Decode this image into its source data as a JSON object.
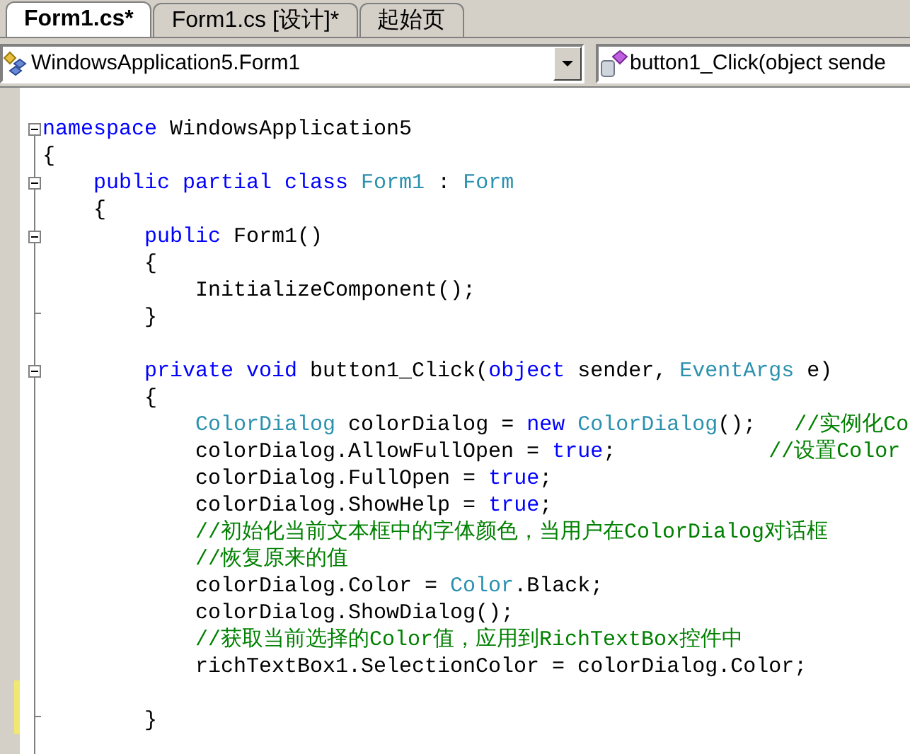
{
  "tabs": [
    {
      "label": "Form1.cs*",
      "selected": true
    },
    {
      "label": "Form1.cs [设计]*",
      "selected": false
    },
    {
      "label": "起始页",
      "selected": false
    }
  ],
  "type_combo": {
    "value": "WindowsApplication5.Form1"
  },
  "member_combo": {
    "value": "button1_Click(object sende"
  },
  "lines": [
    {
      "collapsible": true,
      "block_end": false,
      "modified": false,
      "tokens": [
        {
          "kind": "kw",
          "text": "namespace"
        },
        {
          "kind": "text",
          "text": " WindowsApplication5"
        }
      ]
    },
    {
      "collapsible": false,
      "block_end": false,
      "modified": false,
      "tokens": [
        {
          "kind": "text",
          "text": "{"
        }
      ]
    },
    {
      "collapsible": true,
      "block_end": false,
      "modified": false,
      "tokens": [
        {
          "kind": "kw",
          "text": "    public partial class"
        },
        {
          "kind": "type",
          "text": " Form1"
        },
        {
          "kind": "text",
          "text": " : "
        },
        {
          "kind": "type",
          "text": "Form"
        }
      ]
    },
    {
      "collapsible": false,
      "block_end": false,
      "modified": false,
      "tokens": [
        {
          "kind": "text",
          "text": "    {"
        }
      ]
    },
    {
      "collapsible": true,
      "block_end": false,
      "modified": false,
      "tokens": [
        {
          "kind": "kw",
          "text": "        public"
        },
        {
          "kind": "text",
          "text": " Form1()"
        }
      ]
    },
    {
      "collapsible": false,
      "block_end": false,
      "modified": false,
      "tokens": [
        {
          "kind": "text",
          "text": "        {"
        }
      ]
    },
    {
      "collapsible": false,
      "block_end": false,
      "modified": false,
      "tokens": [
        {
          "kind": "text",
          "text": "            InitializeComponent();"
        }
      ]
    },
    {
      "collapsible": false,
      "block_end": true,
      "modified": false,
      "tokens": [
        {
          "kind": "text",
          "text": "        }"
        }
      ]
    },
    {
      "collapsible": false,
      "block_end": false,
      "modified": false
    },
    {
      "collapsible": true,
      "block_end": false,
      "modified": false,
      "tokens": [
        {
          "kind": "kw",
          "text": "        private void"
        },
        {
          "kind": "text",
          "text": " button1_Click("
        },
        {
          "kind": "kw",
          "text": "object"
        },
        {
          "kind": "text",
          "text": " sender, "
        },
        {
          "kind": "type",
          "text": "EventArgs"
        },
        {
          "kind": "text",
          "text": " e)"
        }
      ]
    },
    {
      "collapsible": false,
      "block_end": false,
      "modified": false,
      "tokens": [
        {
          "kind": "text",
          "text": "        {"
        }
      ]
    },
    {
      "collapsible": false,
      "block_end": false,
      "modified": false,
      "tokens": [
        {
          "kind": "type",
          "text": "            ColorDialog"
        },
        {
          "kind": "text",
          "text": " colorDialog = "
        },
        {
          "kind": "kw",
          "text": "new"
        },
        {
          "kind": "type",
          "text": " ColorDialog"
        },
        {
          "kind": "text",
          "text": "();   "
        },
        {
          "kind": "comment",
          "text": "//实例化Co"
        }
      ]
    },
    {
      "collapsible": false,
      "block_end": false,
      "modified": false,
      "tokens": [
        {
          "kind": "text",
          "text": "            colorDialog.AllowFullOpen = "
        },
        {
          "kind": "kw",
          "text": "true"
        },
        {
          "kind": "text",
          "text": ";            "
        },
        {
          "kind": "comment",
          "text": "//设置Color"
        }
      ]
    },
    {
      "collapsible": false,
      "block_end": false,
      "modified": false,
      "tokens": [
        {
          "kind": "text",
          "text": "            colorDialog.FullOpen = "
        },
        {
          "kind": "kw",
          "text": "true"
        },
        {
          "kind": "text",
          "text": ";"
        }
      ]
    },
    {
      "collapsible": false,
      "block_end": false,
      "modified": false,
      "tokens": [
        {
          "kind": "text",
          "text": "            colorDialog.ShowHelp = "
        },
        {
          "kind": "kw",
          "text": "true"
        },
        {
          "kind": "text",
          "text": ";"
        }
      ]
    },
    {
      "collapsible": false,
      "block_end": false,
      "modified": false,
      "tokens": [
        {
          "kind": "comment",
          "text": "            //初始化当前文本框中的字体颜色，当用户在ColorDialog对话框"
        }
      ]
    },
    {
      "collapsible": false,
      "block_end": false,
      "modified": false,
      "tokens": [
        {
          "kind": "comment",
          "text": "            //恢复原来的值"
        }
      ]
    },
    {
      "collapsible": false,
      "block_end": false,
      "modified": false,
      "tokens": [
        {
          "kind": "text",
          "text": "            colorDialog.Color = "
        },
        {
          "kind": "type",
          "text": "Color"
        },
        {
          "kind": "text",
          "text": ".Black;"
        }
      ]
    },
    {
      "collapsible": false,
      "block_end": false,
      "modified": false,
      "tokens": [
        {
          "kind": "text",
          "text": "            colorDialog.ShowDialog();"
        }
      ]
    },
    {
      "collapsible": false,
      "block_end": false,
      "modified": false,
      "tokens": [
        {
          "kind": "comment",
          "text": "            //获取当前选择的Color值，应用到RichTextBox控件中"
        }
      ]
    },
    {
      "collapsible": false,
      "block_end": false,
      "modified": false,
      "tokens": [
        {
          "kind": "text",
          "text": "            richTextBox1.SelectionColor = colorDialog.Color;"
        }
      ]
    },
    {
      "collapsible": false,
      "block_end": false,
      "modified": true
    },
    {
      "collapsible": false,
      "block_end": true,
      "modified": true,
      "tokens": [
        {
          "kind": "text",
          "text": "        }"
        }
      ]
    }
  ]
}
